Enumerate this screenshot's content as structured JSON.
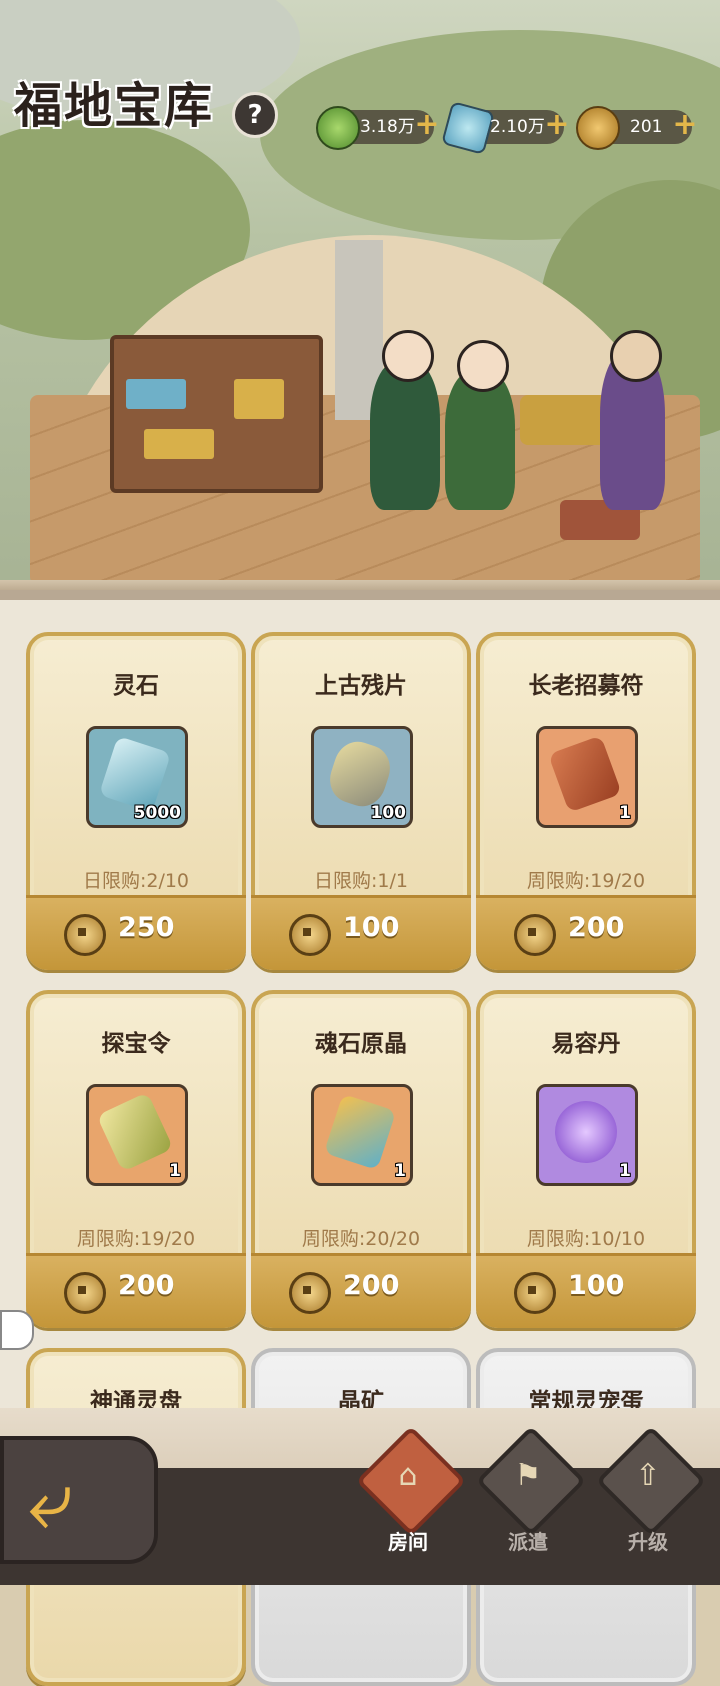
{
  "header": {
    "title": "福地宝库",
    "help_label": "?"
  },
  "currencies": [
    {
      "icon": "spirit-energy-icon",
      "value": "3.18万"
    },
    {
      "icon": "spirit-stone-icon",
      "value": "2.10万"
    },
    {
      "icon": "copper-coin-icon",
      "value": "201"
    }
  ],
  "shop": {
    "items": [
      {
        "name": "灵石",
        "qty": "5000",
        "limit": "日限购:2/10",
        "price": "250"
      },
      {
        "name": "上古残片",
        "qty": "100",
        "limit": "日限购:1/1",
        "price": "100"
      },
      {
        "name": "长老招募符",
        "qty": "1",
        "limit": "周限购:19/20",
        "price": "200"
      },
      {
        "name": "探宝令",
        "qty": "1",
        "limit": "周限购:19/20",
        "price": "200"
      },
      {
        "name": "魂石原晶",
        "qty": "1",
        "limit": "周限购:20/20",
        "price": "200"
      },
      {
        "name": "易容丹",
        "qty": "1",
        "limit": "周限购:10/10",
        "price": "100"
      },
      {
        "name": "神通灵盘"
      },
      {
        "name": "晶矿"
      },
      {
        "name": "常规灵宠蛋"
      }
    ]
  },
  "nav": {
    "tabs": [
      {
        "label": "房间",
        "active": true
      },
      {
        "label": "派遣",
        "active": false
      },
      {
        "label": "升级",
        "active": false
      }
    ]
  },
  "colors": {
    "gold": "#c9a552",
    "coin": "#a87a2a",
    "active_tab": "#c06040"
  }
}
